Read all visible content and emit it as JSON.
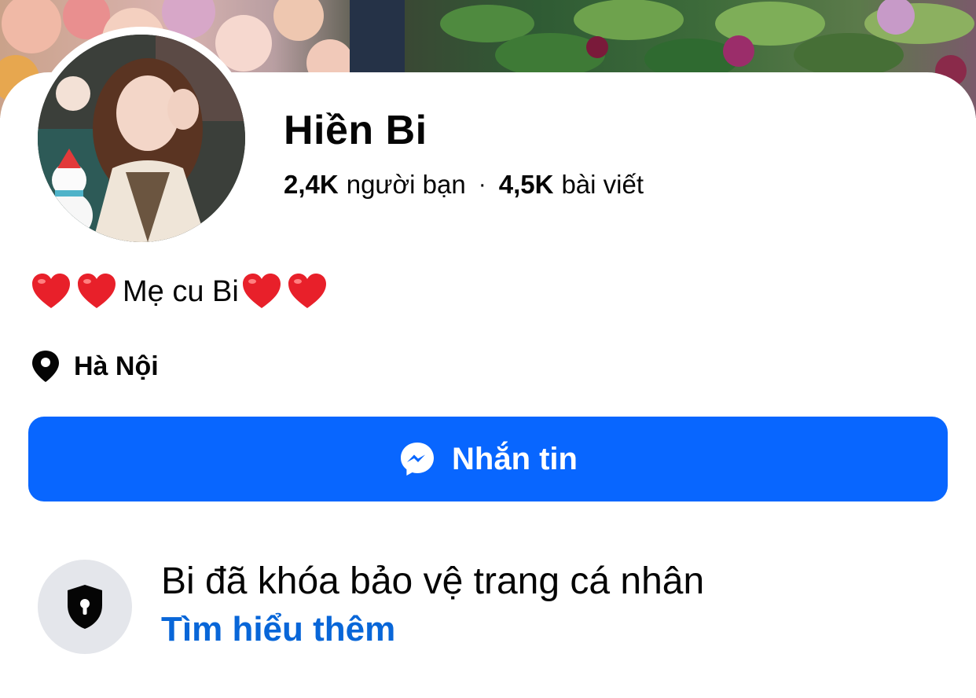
{
  "profile": {
    "name": "Hiền Bi",
    "friends_count": "2,4K",
    "friends_label": "người bạn",
    "separator": "·",
    "posts_count": "4,5K",
    "posts_label": "bài viết",
    "bio_text": "Mẹ cu Bi",
    "location": "Hà Nội"
  },
  "actions": {
    "message_label": "Nhắn tin"
  },
  "lock_notice": {
    "title": "Bi đã khóa bảo vệ trang cá nhân",
    "link": "Tìm hiểu thêm"
  },
  "colors": {
    "primary_button": "#0866ff",
    "link": "#0866d8",
    "heart": "#e8202a",
    "icon_bg": "#e4e6eb"
  },
  "icons": {
    "heart": "heart-icon",
    "location": "location-pin-icon",
    "messenger": "messenger-icon",
    "lock": "shield-lock-icon"
  }
}
